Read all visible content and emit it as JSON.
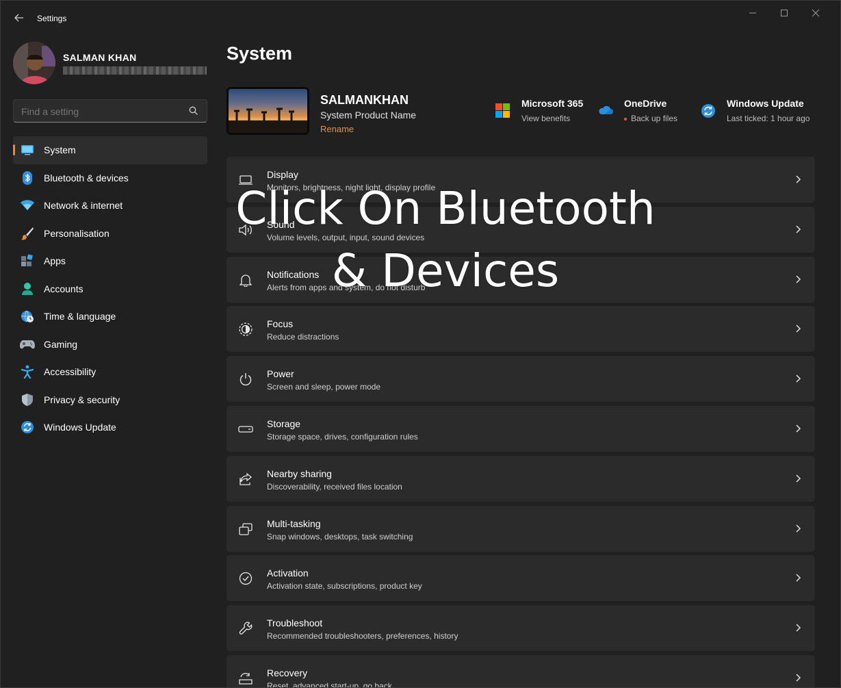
{
  "window": {
    "title": "Settings"
  },
  "profile": {
    "name": "SALMAN KHAN"
  },
  "search": {
    "placeholder": "Find a setting"
  },
  "sidebar": {
    "items": [
      {
        "label": "System",
        "icon": "system-icon",
        "active": true
      },
      {
        "label": "Bluetooth & devices",
        "icon": "bluetooth-icon"
      },
      {
        "label": "Network & internet",
        "icon": "wifi-icon"
      },
      {
        "label": "Personalisation",
        "icon": "brush-icon"
      },
      {
        "label": "Apps",
        "icon": "apps-icon"
      },
      {
        "label": "Accounts",
        "icon": "person-icon"
      },
      {
        "label": "Time & language",
        "icon": "globe-clock-icon"
      },
      {
        "label": "Gaming",
        "icon": "gamepad-icon"
      },
      {
        "label": "Accessibility",
        "icon": "accessibility-icon"
      },
      {
        "label": "Privacy & security",
        "icon": "shield-icon"
      },
      {
        "label": "Windows Update",
        "icon": "update-icon"
      }
    ]
  },
  "main": {
    "title": "System",
    "device": {
      "name": "SALMANKHAN",
      "product": "System Product Name",
      "rename": "Rename"
    },
    "quick_links": [
      {
        "title": "Microsoft 365",
        "sub": "View benefits",
        "icon": "microsoft-logo-icon"
      },
      {
        "title": "OneDrive",
        "sub": "Back up files",
        "icon": "onedrive-cloud-icon",
        "dot_color": "#e05a4a"
      },
      {
        "title": "Windows Update",
        "sub": "Last ticked: 1 hour ago",
        "icon": "update-icon"
      }
    ],
    "cards": [
      {
        "title": "Display",
        "sub": "Monitors, brightness, night light, display profile",
        "icon": "display-icon"
      },
      {
        "title": "Sound",
        "sub": "Volume levels, output, input, sound devices",
        "icon": "speaker-icon"
      },
      {
        "title": "Notifications",
        "sub": "Alerts from apps and system, do not disturb",
        "icon": "bell-icon"
      },
      {
        "title": "Focus",
        "sub": "Reduce distractions",
        "icon": "focus-icon"
      },
      {
        "title": "Power",
        "sub": "Screen and sleep, power mode",
        "icon": "power-icon"
      },
      {
        "title": "Storage",
        "sub": "Storage space, drives, configuration rules",
        "icon": "storage-icon"
      },
      {
        "title": "Nearby sharing",
        "sub": "Discoverability, received files location",
        "icon": "share-icon"
      },
      {
        "title": "Multi-tasking",
        "sub": "Snap windows, desktops, task switching",
        "icon": "multitask-icon"
      },
      {
        "title": "Activation",
        "sub": "Activation state, subscriptions, product key",
        "icon": "check-circle-icon"
      },
      {
        "title": "Troubleshoot",
        "sub": "Recommended troubleshooters, preferences, history",
        "icon": "wrench-icon"
      },
      {
        "title": "Recovery",
        "sub": "Reset, advanced start-up, go back",
        "icon": "recovery-icon"
      }
    ]
  },
  "overlay": {
    "line1": "Click On Bluetooth",
    "line2": "& Devices"
  },
  "colors": {
    "accent": "#f4823a",
    "rename": "#e08e50",
    "window_bg": "#202020",
    "card_bg": "#2b2b2b"
  }
}
